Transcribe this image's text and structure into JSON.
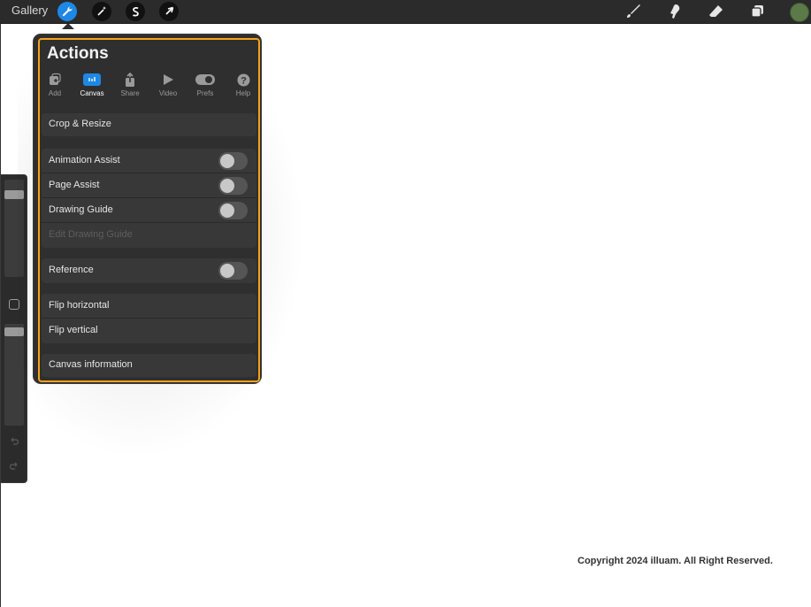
{
  "topbar": {
    "gallery_label": "Gallery",
    "left_tools": [
      "wrench-icon",
      "magic-wand-icon",
      "selection-s-icon",
      "transform-arrow-icon"
    ],
    "right_tools": [
      "brush-icon",
      "smudge-icon",
      "eraser-icon",
      "layers-icon"
    ],
    "active_color": "#5a7a4a",
    "accent": "#1e88e5"
  },
  "panel": {
    "title": "Actions",
    "highlight_color": "#f5a21a",
    "tabs": [
      {
        "label": "Add",
        "icon": "add-image-icon"
      },
      {
        "label": "Canvas",
        "icon": "canvas-icon"
      },
      {
        "label": "Share",
        "icon": "share-icon"
      },
      {
        "label": "Video",
        "icon": "play-icon"
      },
      {
        "label": "Prefs",
        "icon": "toggle-icon"
      },
      {
        "label": "Help",
        "icon": "help-icon"
      }
    ],
    "selected_tab": "Canvas",
    "items": {
      "crop_resize": "Crop & Resize",
      "animation_assist": "Animation Assist",
      "page_assist": "Page Assist",
      "drawing_guide": "Drawing Guide",
      "edit_drawing_guide": "Edit Drawing Guide",
      "reference": "Reference",
      "flip_horizontal": "Flip horizontal",
      "flip_vertical": "Flip vertical",
      "canvas_information": "Canvas information"
    },
    "toggles": {
      "animation_assist": false,
      "page_assist": false,
      "drawing_guide": false,
      "reference": false
    }
  },
  "sidebar": {
    "brush_size_level": 0.3,
    "opacity_level": 0.08,
    "undo_icon": "undo-icon",
    "redo_icon": "redo-icon"
  },
  "footer": {
    "copyright": "Copyright 2024 illuam. All Right Reserved."
  }
}
